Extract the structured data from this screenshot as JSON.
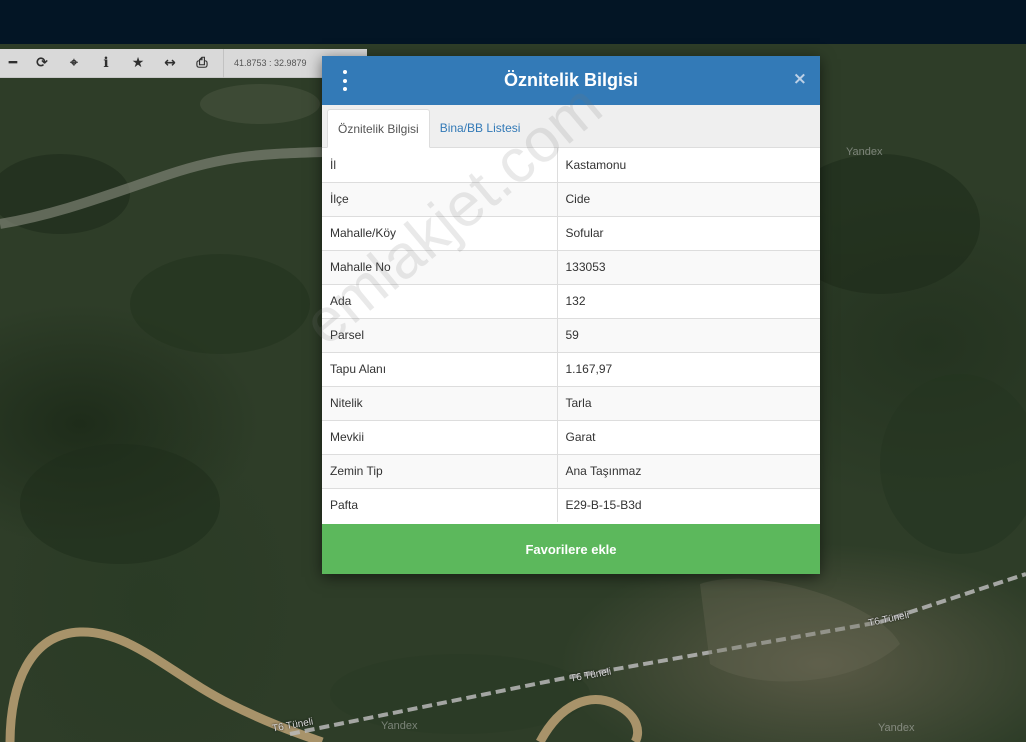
{
  "map": {
    "coordinates": "41.8753 : 32.9879",
    "labels": [
      "T6 Tüneli",
      "T6 Tüneli",
      "T6 Tüneli"
    ],
    "watermark": "Yandex"
  },
  "toolbar": {
    "buttons": [
      {
        "icon": "minus-icon",
        "glyph": "━"
      },
      {
        "icon": "refresh-icon",
        "glyph": "⟳"
      },
      {
        "icon": "crosshair-icon",
        "glyph": "⌖"
      },
      {
        "icon": "info-icon",
        "glyph": "i"
      },
      {
        "icon": "star-icon",
        "glyph": "★"
      },
      {
        "icon": "measure-icon",
        "glyph": "↔"
      },
      {
        "icon": "print-icon",
        "glyph": "⎙"
      }
    ]
  },
  "modal": {
    "title": "Öznitelik Bilgisi",
    "close": "×",
    "tabs": [
      {
        "label": "Öznitelik Bilgisi",
        "active": true
      },
      {
        "label": "Bina/BB Listesi",
        "active": false
      }
    ],
    "rows": [
      {
        "key": "İl",
        "value": "Kastamonu"
      },
      {
        "key": "İlçe",
        "value": "Cide"
      },
      {
        "key": "Mahalle/Köy",
        "value": "Sofular"
      },
      {
        "key": "Mahalle No",
        "value": "133053"
      },
      {
        "key": "Ada",
        "value": "132"
      },
      {
        "key": "Parsel",
        "value": "59"
      },
      {
        "key": "Tapu Alanı",
        "value": "1.167,97"
      },
      {
        "key": "Nitelik",
        "value": "Tarla"
      },
      {
        "key": "Mevkii",
        "value": "Garat"
      },
      {
        "key": "Zemin Tip",
        "value": "Ana Taşınmaz"
      },
      {
        "key": "Pafta",
        "value": "E29-B-15-B3d"
      }
    ],
    "favorite_button": "Favorilere ekle"
  },
  "page_watermark": "emlakjet.com",
  "colors": {
    "topbar": "#031525",
    "header": "#337ab7",
    "button": "#5cb85c"
  }
}
